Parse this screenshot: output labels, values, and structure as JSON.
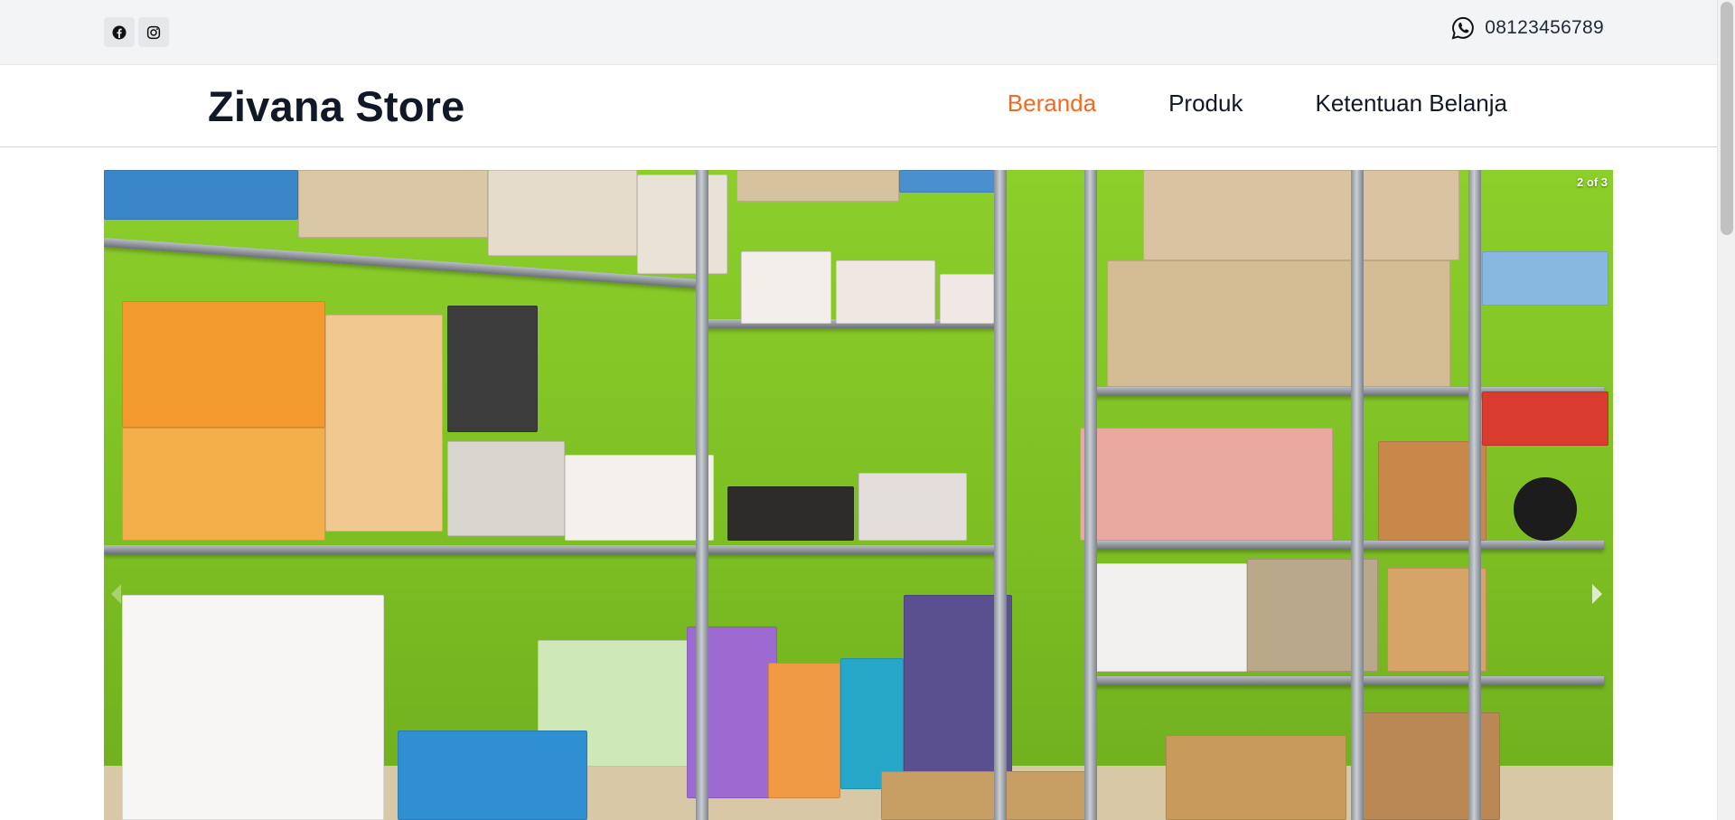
{
  "topbar": {
    "social": [
      {
        "icon": "facebook-icon"
      },
      {
        "icon": "instagram-icon"
      }
    ],
    "contact": {
      "icon": "whatsapp-icon",
      "phone": "08123456789"
    }
  },
  "header": {
    "brand": "Zivana Store",
    "nav": [
      {
        "label": "Beranda",
        "active": true
      },
      {
        "label": "Produk",
        "active": false
      },
      {
        "label": "Ketentuan Belanja",
        "active": false
      }
    ],
    "accent_color": "#f26a21"
  },
  "carousel": {
    "counter": "2 of 3",
    "image_alt_subject": "store-shelves-photo"
  }
}
